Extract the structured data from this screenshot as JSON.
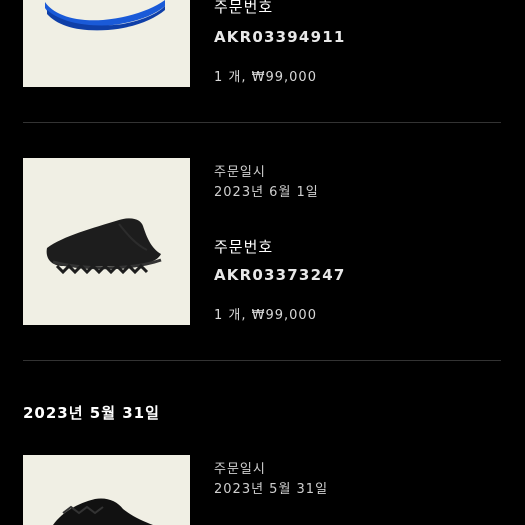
{
  "orders": [
    {
      "order_no_label": "주문번호",
      "order_no": "AKR03394911",
      "qty_price": "1 개, ₩99,000",
      "product_color": "#1a5ad8"
    },
    {
      "order_date_label": "주문일시",
      "order_date": "2023년 6월 1일",
      "order_no_label": "주문번호",
      "order_no": "AKR03373247",
      "qty_price": "1 개, ₩99,000",
      "product_color": "#222222"
    },
    {
      "order_date_label": "주문일시",
      "order_date": "2023년 5월 31일",
      "product_color": "#111111"
    }
  ],
  "group_header": "2023년 5월 31일",
  "colors": {
    "background": "#000000",
    "thumb_bg": "#f0efe4",
    "divider": "#333333"
  }
}
